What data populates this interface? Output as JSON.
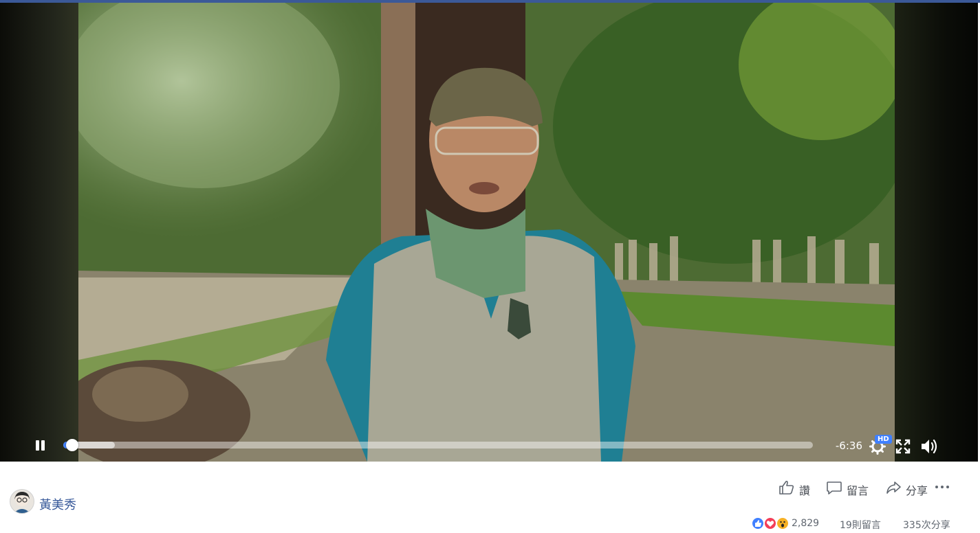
{
  "player": {
    "time_remaining": "-6:36",
    "quality_badge": "HD",
    "progress": {
      "played_fraction": 0.012,
      "buffered_fraction": 0.069
    }
  },
  "post": {
    "author_name": "黃美秀",
    "actions": {
      "like_label": "讚",
      "comment_label": "留言",
      "share_label": "分享"
    },
    "stats": {
      "reaction_count": "2,829",
      "comments": "19則留言",
      "shares": "335次分享"
    },
    "reaction_icons": [
      "like-reaction-icon",
      "love-reaction-icon",
      "wow-reaction-icon"
    ]
  },
  "colors": {
    "accent": "#4080ff",
    "link": "#365899",
    "topbar": "#3b5998"
  }
}
